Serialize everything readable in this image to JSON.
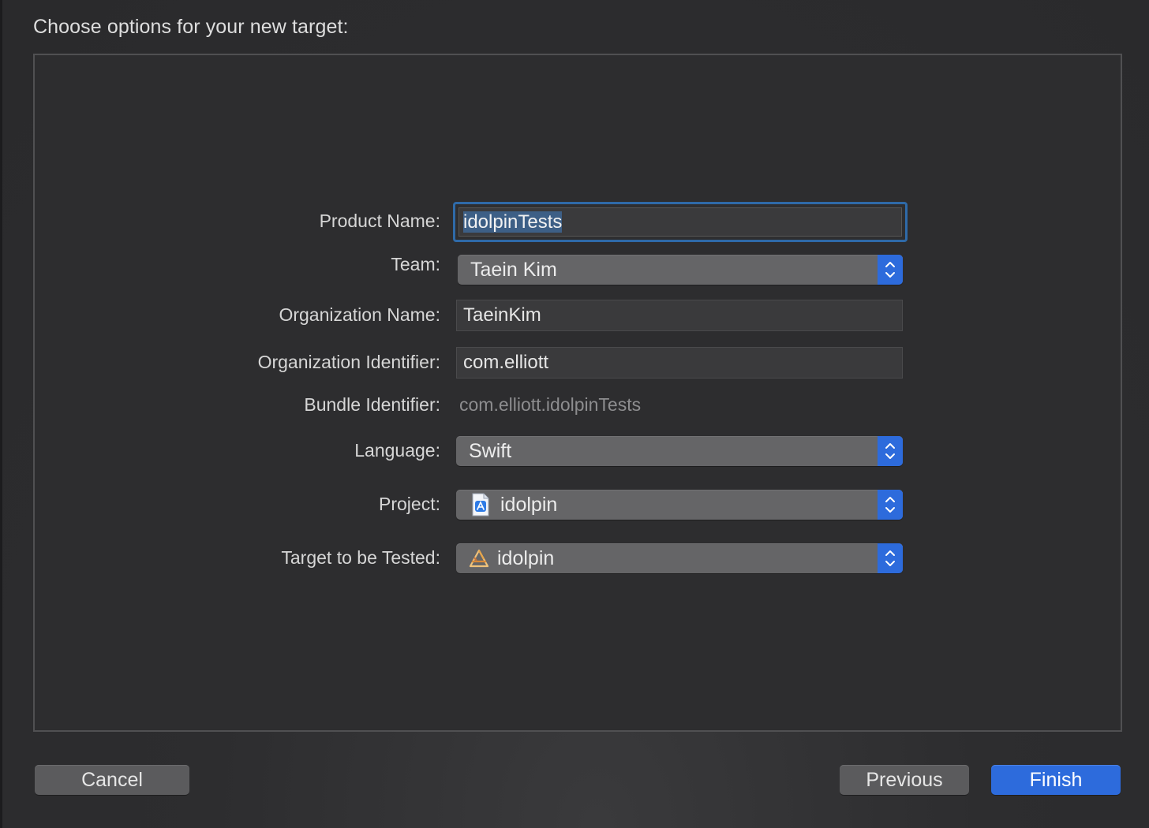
{
  "dialog": {
    "heading": "Choose options for your new target:"
  },
  "form": {
    "product_name": {
      "label": "Product Name:",
      "value": "idolpinTests"
    },
    "team": {
      "label": "Team:",
      "value": "Taein Kim"
    },
    "organization_name": {
      "label": "Organization Name:",
      "value": "TaeinKim"
    },
    "organization_identifier": {
      "label": "Organization Identifier:",
      "value": "com.elliott"
    },
    "bundle_identifier": {
      "label": "Bundle Identifier:",
      "value": "com.elliott.idolpinTests"
    },
    "language": {
      "label": "Language:",
      "value": "Swift"
    },
    "project": {
      "label": "Project:",
      "value": "idolpin",
      "icon": "xcode-project-file-icon"
    },
    "target_to_be_tested": {
      "label": "Target to be Tested:",
      "value": "idolpin",
      "icon": "app-target-icon"
    }
  },
  "buttons": {
    "cancel": "Cancel",
    "previous": "Previous",
    "finish": "Finish"
  },
  "colors": {
    "accent": "#2d6bdc",
    "focus_ring": "#2f6aa8",
    "background": "#2b2b2d"
  }
}
